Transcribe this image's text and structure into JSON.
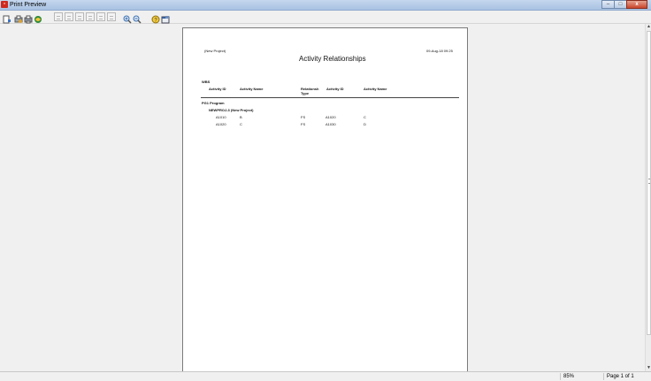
{
  "window": {
    "title": "Print Preview"
  },
  "toolbar": {
    "buttons": [
      "page-setup-icon",
      "print-options-icon",
      "print-icon",
      "export-icon",
      "first-page-icon",
      "previous-page-icon",
      "next-page-icon",
      "last-page-icon",
      "go-to-page-icon",
      "single-page-icon",
      "zoom-in-icon",
      "zoom-out-icon",
      "help-icon",
      "close-preview-icon"
    ]
  },
  "report": {
    "project": "(New Project)",
    "date": "09-Aug-18 09:25",
    "title": "Activity Relationships",
    "section_label": "WBS",
    "columns": {
      "activity_id": "Activity ID",
      "activity_name": "Activity Name",
      "relationship_type_line1": "Relationsh",
      "relationship_type_line2": "Type",
      "successor_id": "Activity ID",
      "successor_name": "Activity Name"
    },
    "group": "PG1  Program",
    "subgroup": "NEWPROJ-3  (New Project)",
    "rows": [
      {
        "id": "A1010",
        "name": "B",
        "type": "FS",
        "succ_id": "A1020",
        "succ_name": "C"
      },
      {
        "id": "A1020",
        "name": "C",
        "type": "FS",
        "succ_id": "A1030",
        "succ_name": "D"
      }
    ]
  },
  "status": {
    "zoom": "85%",
    "page": "Page 1 of 1"
  }
}
